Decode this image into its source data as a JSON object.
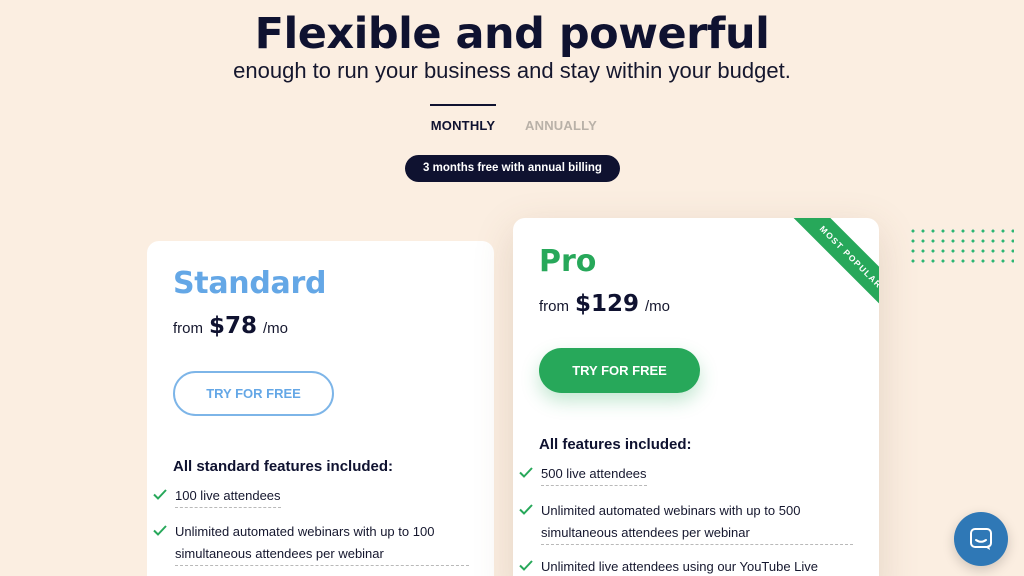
{
  "header": {
    "title": "Flexible and powerful",
    "subtitle": "enough to run your business and stay within your budget."
  },
  "billing_tabs": [
    {
      "label": "MONTHLY",
      "active": true
    },
    {
      "label": "ANNUALLY",
      "active": false
    }
  ],
  "promo_badge": "3 months free with annual billing",
  "plans": {
    "standard": {
      "name": "Standard",
      "price_prefix": "from",
      "price": "$78",
      "price_suffix": "/mo",
      "cta": "TRY FOR FREE",
      "features_title": "All standard features included:",
      "features": [
        "100 live attendees",
        "Unlimited automated webinars with up to 100",
        "simultaneous attendees per webinar"
      ]
    },
    "pro": {
      "name": "Pro",
      "price_prefix": "from",
      "price": "$129",
      "price_suffix": "/mo",
      "cta": "TRY FOR FREE",
      "ribbon": "MOST POPULAR",
      "features_title": "All features included:",
      "features": [
        "500 live attendees",
        "Unlimited automated webinars with up to 500",
        "simultaneous attendees per webinar",
        "Unlimited live attendees using our YouTube Live"
      ]
    }
  },
  "colors": {
    "background": "#fbeee1",
    "navy": "#0f1230",
    "standard_blue": "#64a7e6",
    "pro_green": "#27a85a",
    "chat_blue": "#2f78b6"
  },
  "icons": {
    "check": "check-icon",
    "chat": "chat-icon"
  }
}
